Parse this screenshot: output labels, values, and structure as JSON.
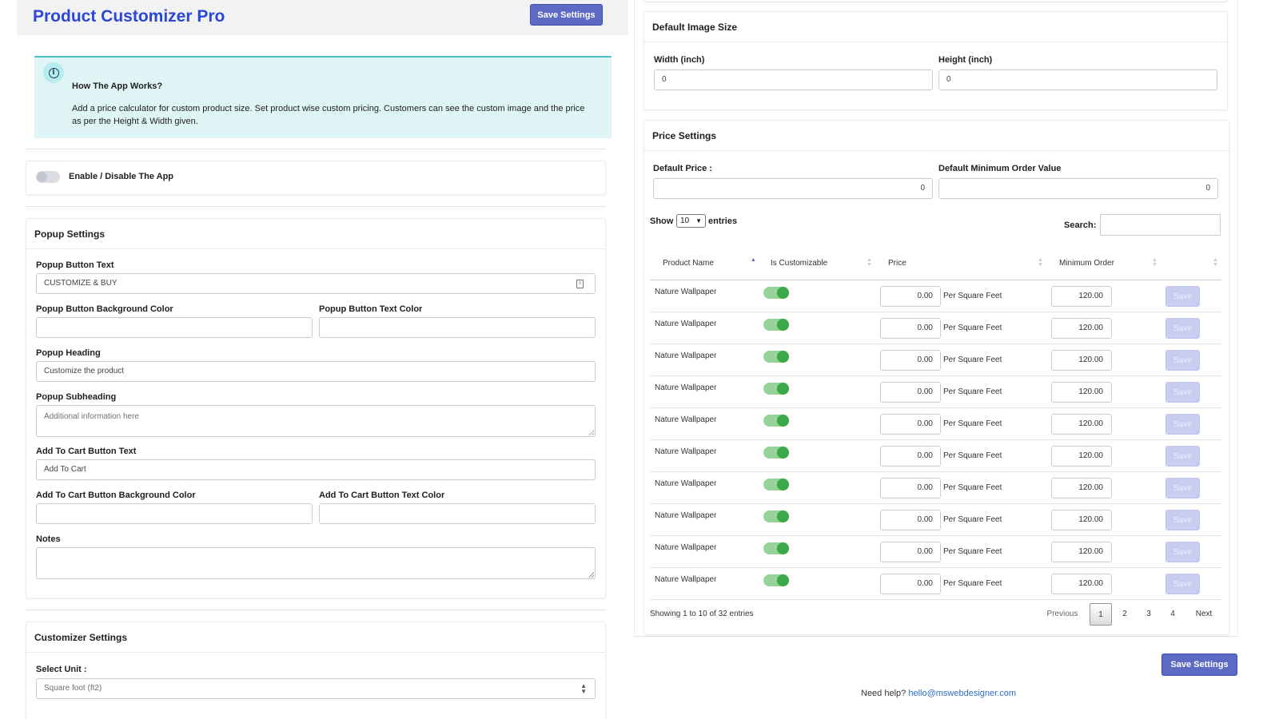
{
  "header": {
    "title": "Product Customizer Pro",
    "save_label": "Save Settings"
  },
  "info": {
    "title": "How The App Works?",
    "text": "Add a price calculator for custom product size. Set product wise custom pricing. Customers can see the custom image and the price as per the Height & Width given."
  },
  "toggle": {
    "label": "Enable / Disable The App",
    "enabled": false
  },
  "popup": {
    "title": "Popup Settings",
    "button_text_label": "Popup Button Text",
    "button_text_value": "CUSTOMIZE & BUY",
    "bg_color_label": "Popup Button Background Color",
    "text_color_label": "Popup Button Text Color",
    "heading_label": "Popup Heading",
    "heading_value": "Customize the product",
    "subheading_label": "Popup Subheading",
    "subheading_placeholder": "Additional information here",
    "cart_text_label": "Add To Cart Button Text",
    "cart_text_value": "Add To Cart",
    "cart_bg_label": "Add To Cart Button Background Color",
    "cart_color_label": "Add To Cart Button Text Color",
    "notes_label": "Notes"
  },
  "customizer": {
    "title": "Customizer Settings",
    "unit_label": "Select Unit :",
    "unit_value": "Square foot (ft2)"
  },
  "image_size": {
    "title": "Default Image Size",
    "width_label": "Width (inch)",
    "width_value": "0",
    "height_label": "Height (inch)",
    "height_value": "0"
  },
  "price": {
    "title": "Price Settings",
    "default_price_label": "Default Price :",
    "default_price_value": "0",
    "min_order_label": "Default Minimum Order Value",
    "min_order_value": "0"
  },
  "table": {
    "show_label": "Show",
    "show_value": "10",
    "entries_label": "entries",
    "search_label": "Search:",
    "columns": [
      "Product Name",
      "Is Customizable",
      "Price",
      "Minimum Order"
    ],
    "rows": [
      {
        "name": "Nature Wallpaper",
        "customizable": true,
        "price": "0.00",
        "unit": "Per Square Feet",
        "min": "120.00",
        "save": "Save"
      },
      {
        "name": "Nature Wallpaper",
        "customizable": true,
        "price": "0.00",
        "unit": "Per Square Feet",
        "min": "120.00",
        "save": "Save"
      },
      {
        "name": "Nature Wallpaper",
        "customizable": true,
        "price": "0.00",
        "unit": "Per Square Feet",
        "min": "120.00",
        "save": "Save"
      },
      {
        "name": "Nature Wallpaper",
        "customizable": true,
        "price": "0.00",
        "unit": "Per Square Feet",
        "min": "120.00",
        "save": "Save"
      },
      {
        "name": "Nature Wallpaper",
        "customizable": true,
        "price": "0.00",
        "unit": "Per Square Feet",
        "min": "120.00",
        "save": "Save"
      },
      {
        "name": "Nature Wallpaper",
        "customizable": true,
        "price": "0.00",
        "unit": "Per Square Feet",
        "min": "120.00",
        "save": "Save"
      },
      {
        "name": "Nature Wallpaper",
        "customizable": true,
        "price": "0.00",
        "unit": "Per Square Feet",
        "min": "120.00",
        "save": "Save"
      },
      {
        "name": "Nature Wallpaper",
        "customizable": true,
        "price": "0.00",
        "unit": "Per Square Feet",
        "min": "120.00",
        "save": "Save"
      },
      {
        "name": "Nature Wallpaper",
        "customizable": true,
        "price": "0.00",
        "unit": "Per Square Feet",
        "min": "120.00",
        "save": "Save"
      },
      {
        "name": "Nature Wallpaper",
        "customizable": true,
        "price": "0.00",
        "unit": "Per Square Feet",
        "min": "120.00",
        "save": "Save"
      }
    ],
    "info": "Showing 1 to 10 of 32 entries",
    "pagination": {
      "previous": "Previous",
      "pages": [
        "1",
        "2",
        "3",
        "4"
      ],
      "next": "Next",
      "current": "1"
    }
  },
  "footer": {
    "save_label": "Save Settings",
    "help_text": "Need help?",
    "help_email": "hello@mswebdesigner.com"
  },
  "colors": {
    "primary": "#5c6ac4",
    "title": "#2b47d6",
    "info_bg": "#e0f5f5",
    "toggle_on": "#3aa848",
    "link": "#2c6ecb"
  }
}
